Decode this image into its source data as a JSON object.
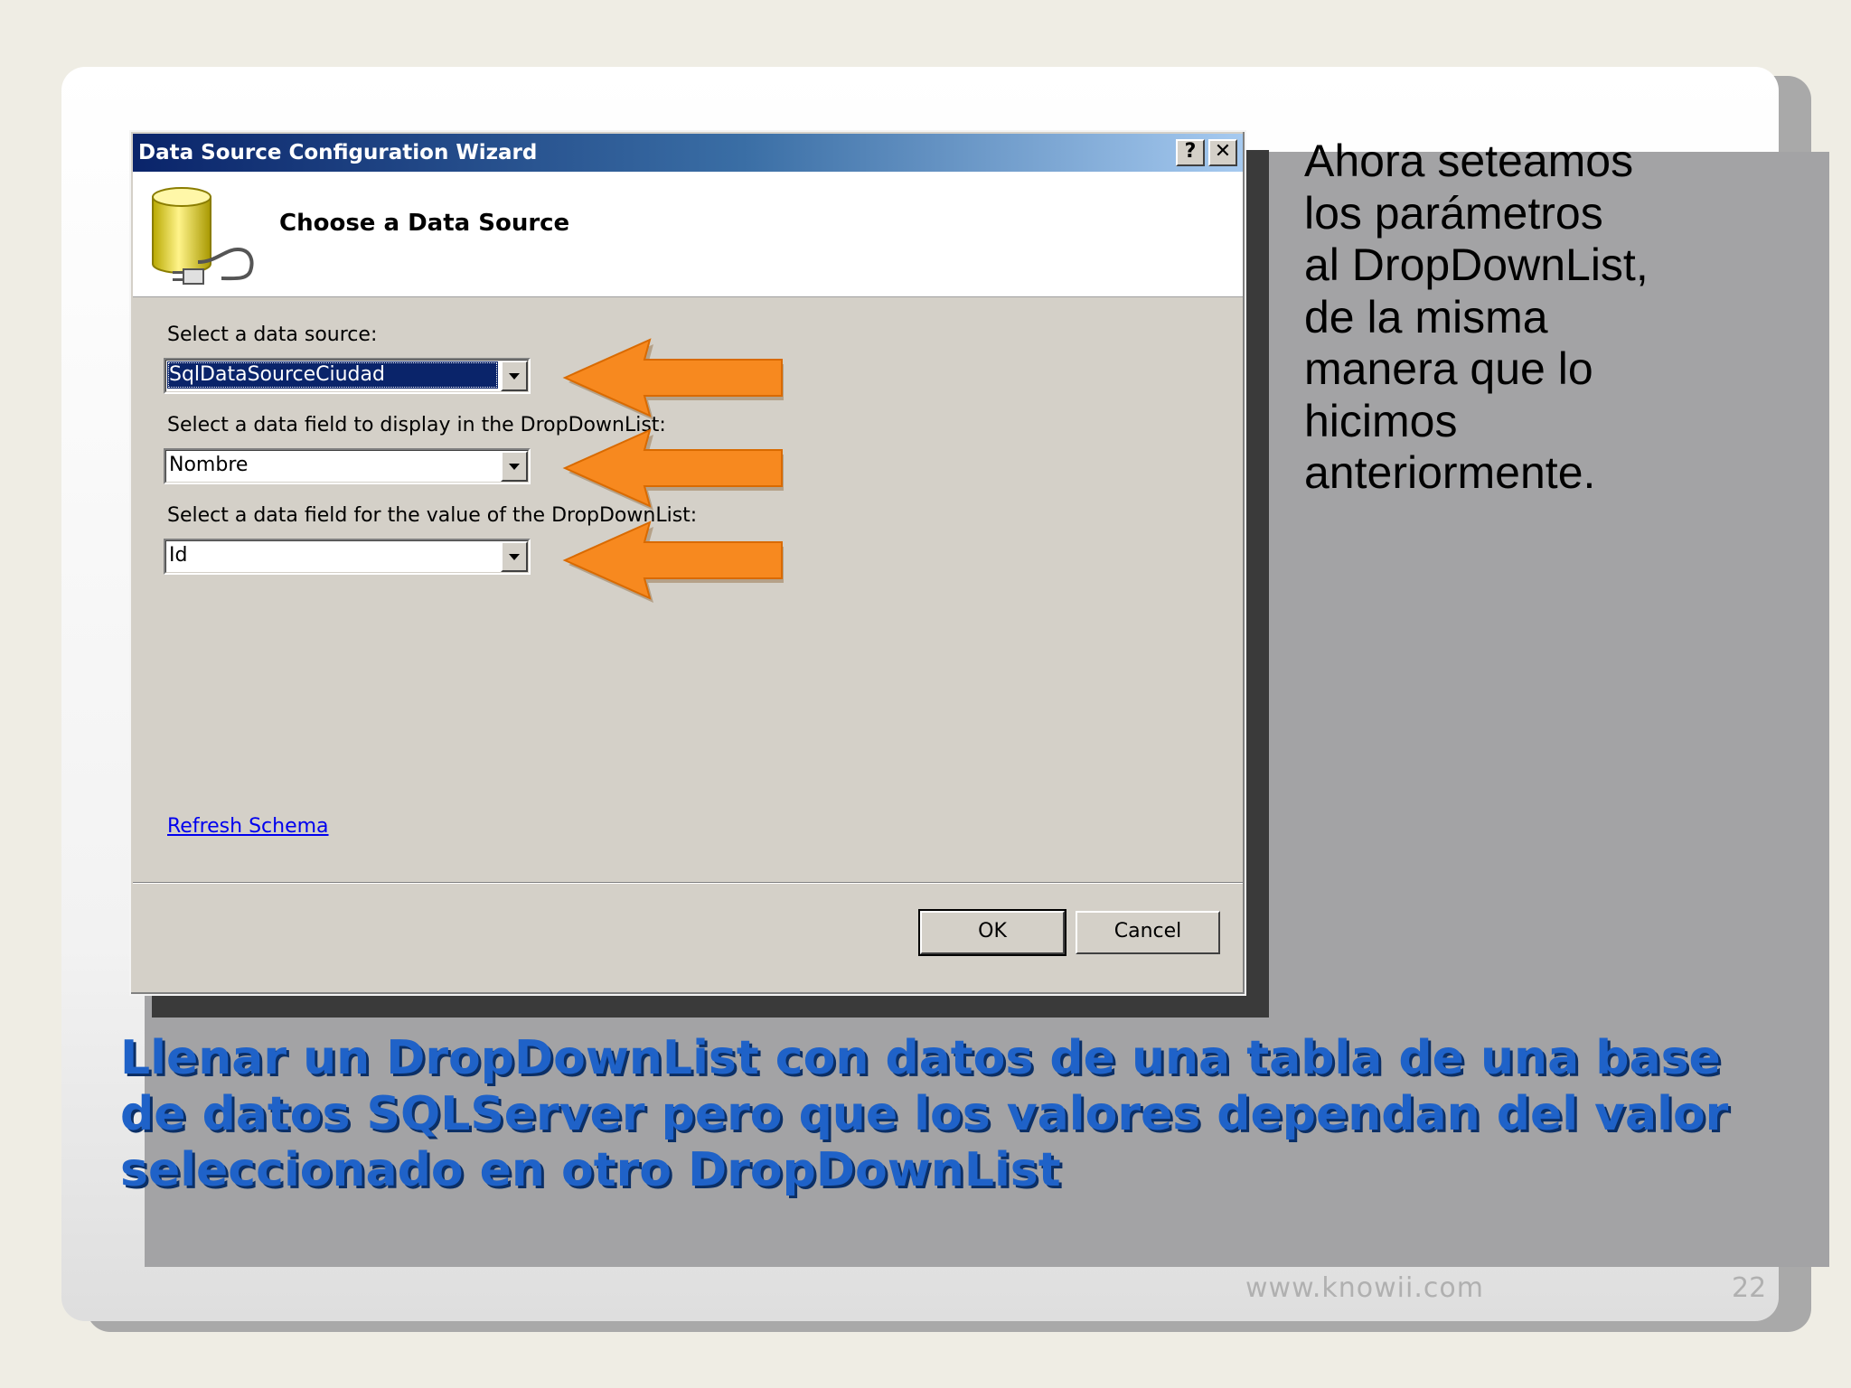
{
  "dialog": {
    "title": "Data Source Configuration Wizard",
    "help_button": "?",
    "close_button": "✕",
    "header_title": "Choose a Data Source",
    "field1": {
      "label": "Select a data source:",
      "value": "SqlDataSourceCiudad"
    },
    "field2": {
      "label": "Select a data field to display in the DropDownList:",
      "value": "Nombre"
    },
    "field3": {
      "label": "Select a data field for the value of the DropDownList:",
      "value": "Id"
    },
    "refresh_link": "Refresh Schema",
    "ok_label": "OK",
    "cancel_label": "Cancel",
    "icon": "database-plug-icon"
  },
  "side_text": "Ahora seteamos\nlos parámetros\nal DropDownList,\nde la misma\nmanera que lo\nhicimos\nanteriormente.",
  "caption": "Llenar un DropDownList con datos de una tabla de una base de datos SQLServer pero que los valores dependan del valor seleccionado en otro DropDownList",
  "footer": {
    "url": "www.knowii.com",
    "page_number": "22"
  },
  "colors": {
    "caption": "#1f62c8",
    "arrow": "#f7891f",
    "titlebar_start": "#0a246a",
    "panel": "#a3a3a5"
  }
}
